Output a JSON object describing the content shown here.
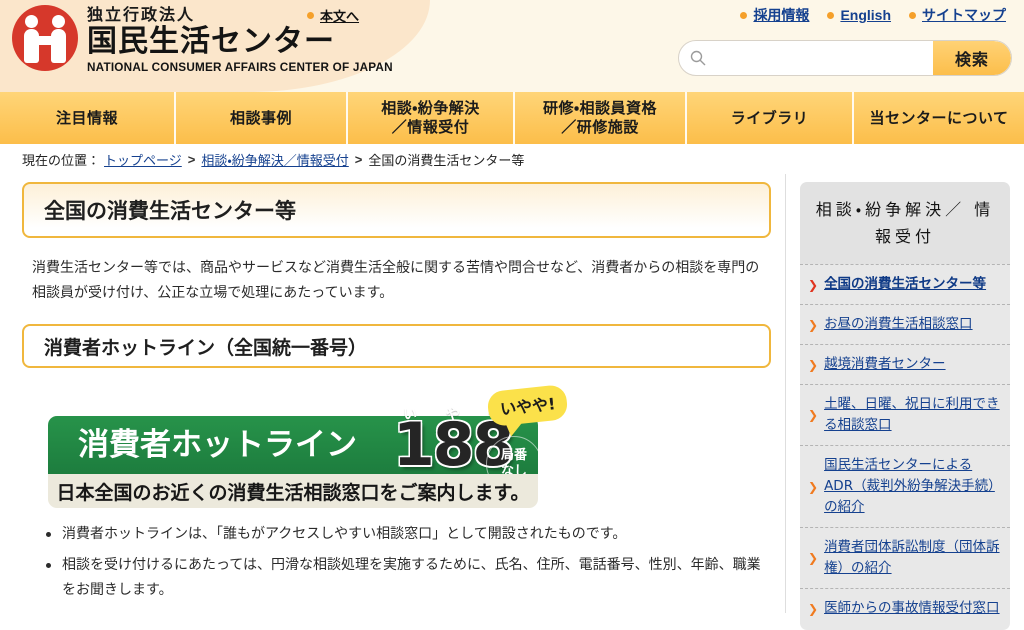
{
  "header": {
    "logo": {
      "org_prefix": "独立行政法人",
      "org_name": "国民生活センター",
      "org_name_en": "NATIONAL CONSUMER AFFAIRS CENTER OF JAPAN",
      "mark_icon": "two-people-circle-logo"
    },
    "skip_link": "本文へ",
    "util_links": [
      {
        "label": "採用情報"
      },
      {
        "label": "English"
      },
      {
        "label": "サイトマップ"
      }
    ],
    "search": {
      "icon": "search-icon",
      "value": "",
      "placeholder": "",
      "button_label": "検索"
    }
  },
  "global_nav": [
    {
      "label": "注目情報"
    },
    {
      "label": "相談事例"
    },
    {
      "label": "相談・紛争解決\n／情報受付"
    },
    {
      "label": "研修・相談員資格\n／研修施設"
    },
    {
      "label": "ライブラリ"
    },
    {
      "label": "当センターについて"
    }
  ],
  "breadcrumb": {
    "prefix": "現在の位置：",
    "items": [
      {
        "label": "トップページ",
        "link": true
      },
      {
        "label": "相談・紛争解決／情報受付",
        "link": true
      },
      {
        "label": "全国の消費生活センター等",
        "link": false
      }
    ],
    "separator": ">"
  },
  "main": {
    "page_title": "全国の消費生活センター等",
    "intro": "消費生活センター等では、商品やサービスなど消費生活全般に関する苦情や問合せなど、消費者からの相談を専門の相談員が受け付け、公正な立場で処理にあたっています。",
    "sub_title": "消費者ホットライン（全国統一番号）",
    "banner": {
      "title": "消費者ホットライン",
      "number": "188",
      "furigana": [
        "い",
        "や",
        "や"
      ],
      "speech_bubble": "いやや!",
      "badge_line1": "局番",
      "badge_line2": "なし",
      "caption": "日本全国のお近くの消費生活相談窓口をご案内します。",
      "green": "#1d7d3e",
      "beige": "#ece9dc",
      "bubble_color": "#fbe14a"
    },
    "bullets": [
      "消費者ホットラインは、「誰もがアクセスしやすい相談窓口」として開設されたものです。",
      "相談を受け付けるにあたっては、円滑な相談処理を実施するために、氏名、住所、電話番号、性別、年齢、職業をお聞きします。"
    ]
  },
  "sidebar": {
    "heading": "相談・紛争解決／\n情報受付",
    "items": [
      {
        "label": "全国の消費生活センター等",
        "active": true
      },
      {
        "label": "お昼の消費生活相談窓口",
        "active": false
      },
      {
        "label": "越境消費者センター",
        "active": false
      },
      {
        "label": "土曜、日曜、祝日に利用できる相談窓口",
        "active": false
      },
      {
        "label": "国民生活センターによるADR（裁判外紛争解決手続）の紹介",
        "active": false
      },
      {
        "label": "消費者団体訴訟制度（団体訴権）の紹介",
        "active": false
      },
      {
        "label": "医師からの事故情報受付窓口",
        "active": false
      }
    ]
  },
  "colors": {
    "accent_amber": "#fcbe4a",
    "header_peach": "#fbe6cb",
    "link_blue": "#15418f",
    "arrow_orange": "#f07a1f",
    "logo_red": "#d6382b"
  }
}
